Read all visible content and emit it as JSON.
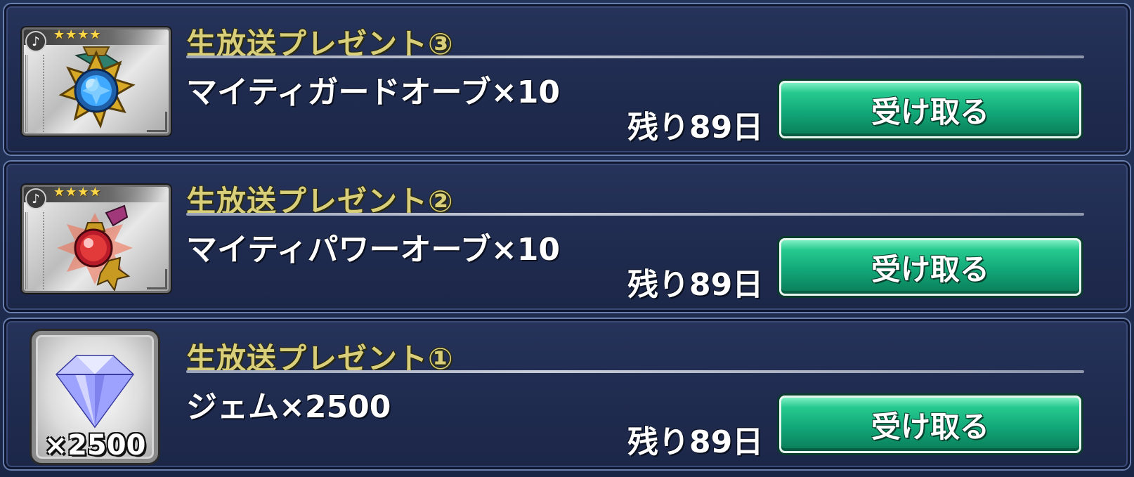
{
  "presents": [
    {
      "title": "生放送プレゼント③",
      "item_name": "マイティガードオーブ×10",
      "remaining": "残り89日",
      "button_label": "受け取る",
      "icon": "mighty-guard-orb-icon",
      "rarity_stars": "★★★★",
      "icon_accent": "#3fa9ff"
    },
    {
      "title": "生放送プレゼント②",
      "item_name": "マイティパワーオーブ×10",
      "remaining": "残り89日",
      "button_label": "受け取る",
      "icon": "mighty-power-orb-icon",
      "rarity_stars": "★★★★",
      "icon_accent": "#e23a3a"
    },
    {
      "title": "生放送プレゼント①",
      "item_name": "ジェム×2500",
      "remaining": "残り89日",
      "button_label": "受け取る",
      "icon": "gem-icon",
      "icon_count": "×2500",
      "icon_accent": "#8a8cff"
    }
  ],
  "colors": {
    "title": "#d9cf7a",
    "button": "#12a878",
    "background": "#1f2b4f"
  }
}
